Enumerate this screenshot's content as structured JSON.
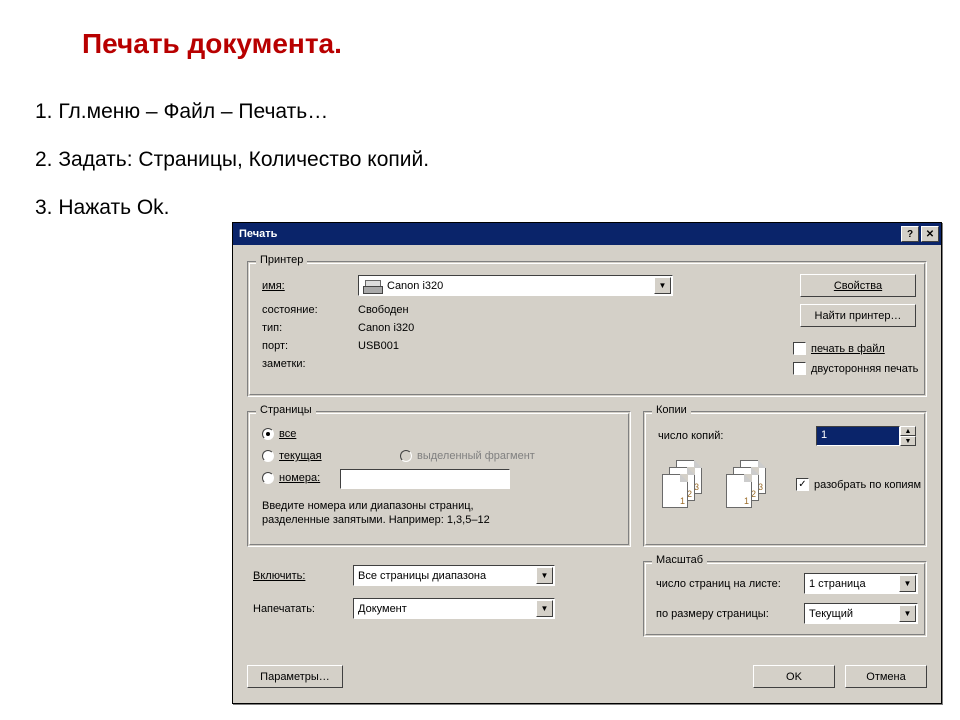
{
  "slide": {
    "title": "Печать документа.",
    "items": [
      "1. Гл.меню – Файл – Печать…",
      "2. Задать: Страницы, Количество копий.",
      "3. Нажать Ok."
    ]
  },
  "dialog": {
    "title": "Печать",
    "help_glyph": "?",
    "close_glyph": "✕",
    "printer": {
      "group_title": "Принтер",
      "name_label": "имя:",
      "name_value": "Canon i320",
      "status_label": "состояние:",
      "status_value": "Свободен",
      "type_label": "тип:",
      "type_value": "Canon i320",
      "port_label": "порт:",
      "port_value": "USB001",
      "notes_label": "заметки:",
      "properties_btn": "Свойства",
      "find_printer_btn": "Найти принтер…",
      "to_file_label": "печать в файл",
      "duplex_label": "двусторонняя печать"
    },
    "pages": {
      "group_title": "Страницы",
      "all": "все",
      "current": "текущая",
      "selection": "выделенный фрагмент",
      "numbers": "номера:",
      "numbers_value": "",
      "hint1": "Введите номера или диапазоны страниц,",
      "hint2": "разделенные запятыми. Например: 1,3,5–12"
    },
    "copies": {
      "group_title": "Копии",
      "count_label": "число копий:",
      "count_value": "1",
      "collate_label": "разобрать по копиям"
    },
    "include": {
      "label": "Включить:",
      "value": "Все страницы диапазона"
    },
    "print_what": {
      "label": "Напечатать:",
      "value": "Документ"
    },
    "scale": {
      "group_title": "Масштаб",
      "pages_per_sheet_label": "число страниц на листе:",
      "pages_per_sheet_value": "1 страница",
      "fit_to_label": "по размеру страницы:",
      "fit_to_value": "Текущий"
    },
    "footer": {
      "options_btn": "Параметры…",
      "ok_btn": "OK",
      "cancel_btn": "Отмена"
    }
  }
}
